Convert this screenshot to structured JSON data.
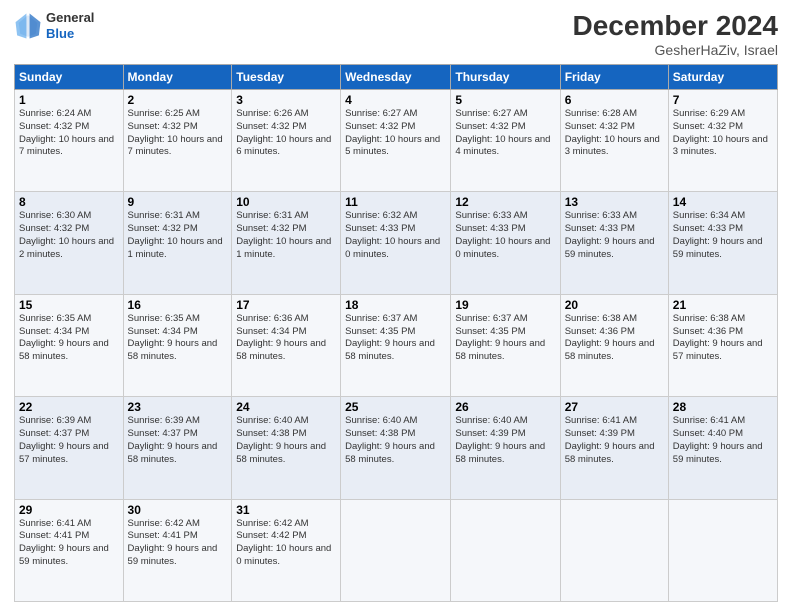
{
  "header": {
    "logo_line1": "General",
    "logo_line2": "Blue",
    "title": "December 2024",
    "subtitle": "GesherHaZiv, Israel"
  },
  "columns": [
    "Sunday",
    "Monday",
    "Tuesday",
    "Wednesday",
    "Thursday",
    "Friday",
    "Saturday"
  ],
  "weeks": [
    [
      {
        "day": "1",
        "sunrise": "6:24 AM",
        "sunset": "4:32 PM",
        "daylight": "10 hours and 7 minutes."
      },
      {
        "day": "2",
        "sunrise": "6:25 AM",
        "sunset": "4:32 PM",
        "daylight": "10 hours and 7 minutes."
      },
      {
        "day": "3",
        "sunrise": "6:26 AM",
        "sunset": "4:32 PM",
        "daylight": "10 hours and 6 minutes."
      },
      {
        "day": "4",
        "sunrise": "6:27 AM",
        "sunset": "4:32 PM",
        "daylight": "10 hours and 5 minutes."
      },
      {
        "day": "5",
        "sunrise": "6:27 AM",
        "sunset": "4:32 PM",
        "daylight": "10 hours and 4 minutes."
      },
      {
        "day": "6",
        "sunrise": "6:28 AM",
        "sunset": "4:32 PM",
        "daylight": "10 hours and 3 minutes."
      },
      {
        "day": "7",
        "sunrise": "6:29 AM",
        "sunset": "4:32 PM",
        "daylight": "10 hours and 3 minutes."
      }
    ],
    [
      {
        "day": "8",
        "sunrise": "6:30 AM",
        "sunset": "4:32 PM",
        "daylight": "10 hours and 2 minutes."
      },
      {
        "day": "9",
        "sunrise": "6:31 AM",
        "sunset": "4:32 PM",
        "daylight": "10 hours and 1 minute."
      },
      {
        "day": "10",
        "sunrise": "6:31 AM",
        "sunset": "4:32 PM",
        "daylight": "10 hours and 1 minute."
      },
      {
        "day": "11",
        "sunrise": "6:32 AM",
        "sunset": "4:33 PM",
        "daylight": "10 hours and 0 minutes."
      },
      {
        "day": "12",
        "sunrise": "6:33 AM",
        "sunset": "4:33 PM",
        "daylight": "10 hours and 0 minutes."
      },
      {
        "day": "13",
        "sunrise": "6:33 AM",
        "sunset": "4:33 PM",
        "daylight": "9 hours and 59 minutes."
      },
      {
        "day": "14",
        "sunrise": "6:34 AM",
        "sunset": "4:33 PM",
        "daylight": "9 hours and 59 minutes."
      }
    ],
    [
      {
        "day": "15",
        "sunrise": "6:35 AM",
        "sunset": "4:34 PM",
        "daylight": "9 hours and 58 minutes."
      },
      {
        "day": "16",
        "sunrise": "6:35 AM",
        "sunset": "4:34 PM",
        "daylight": "9 hours and 58 minutes."
      },
      {
        "day": "17",
        "sunrise": "6:36 AM",
        "sunset": "4:34 PM",
        "daylight": "9 hours and 58 minutes."
      },
      {
        "day": "18",
        "sunrise": "6:37 AM",
        "sunset": "4:35 PM",
        "daylight": "9 hours and 58 minutes."
      },
      {
        "day": "19",
        "sunrise": "6:37 AM",
        "sunset": "4:35 PM",
        "daylight": "9 hours and 58 minutes."
      },
      {
        "day": "20",
        "sunrise": "6:38 AM",
        "sunset": "4:36 PM",
        "daylight": "9 hours and 58 minutes."
      },
      {
        "day": "21",
        "sunrise": "6:38 AM",
        "sunset": "4:36 PM",
        "daylight": "9 hours and 57 minutes."
      }
    ],
    [
      {
        "day": "22",
        "sunrise": "6:39 AM",
        "sunset": "4:37 PM",
        "daylight": "9 hours and 57 minutes."
      },
      {
        "day": "23",
        "sunrise": "6:39 AM",
        "sunset": "4:37 PM",
        "daylight": "9 hours and 58 minutes."
      },
      {
        "day": "24",
        "sunrise": "6:40 AM",
        "sunset": "4:38 PM",
        "daylight": "9 hours and 58 minutes."
      },
      {
        "day": "25",
        "sunrise": "6:40 AM",
        "sunset": "4:38 PM",
        "daylight": "9 hours and 58 minutes."
      },
      {
        "day": "26",
        "sunrise": "6:40 AM",
        "sunset": "4:39 PM",
        "daylight": "9 hours and 58 minutes."
      },
      {
        "day": "27",
        "sunrise": "6:41 AM",
        "sunset": "4:39 PM",
        "daylight": "9 hours and 58 minutes."
      },
      {
        "day": "28",
        "sunrise": "6:41 AM",
        "sunset": "4:40 PM",
        "daylight": "9 hours and 59 minutes."
      }
    ],
    [
      {
        "day": "29",
        "sunrise": "6:41 AM",
        "sunset": "4:41 PM",
        "daylight": "9 hours and 59 minutes."
      },
      {
        "day": "30",
        "sunrise": "6:42 AM",
        "sunset": "4:41 PM",
        "daylight": "9 hours and 59 minutes."
      },
      {
        "day": "31",
        "sunrise": "6:42 AM",
        "sunset": "4:42 PM",
        "daylight": "10 hours and 0 minutes."
      },
      null,
      null,
      null,
      null
    ]
  ]
}
